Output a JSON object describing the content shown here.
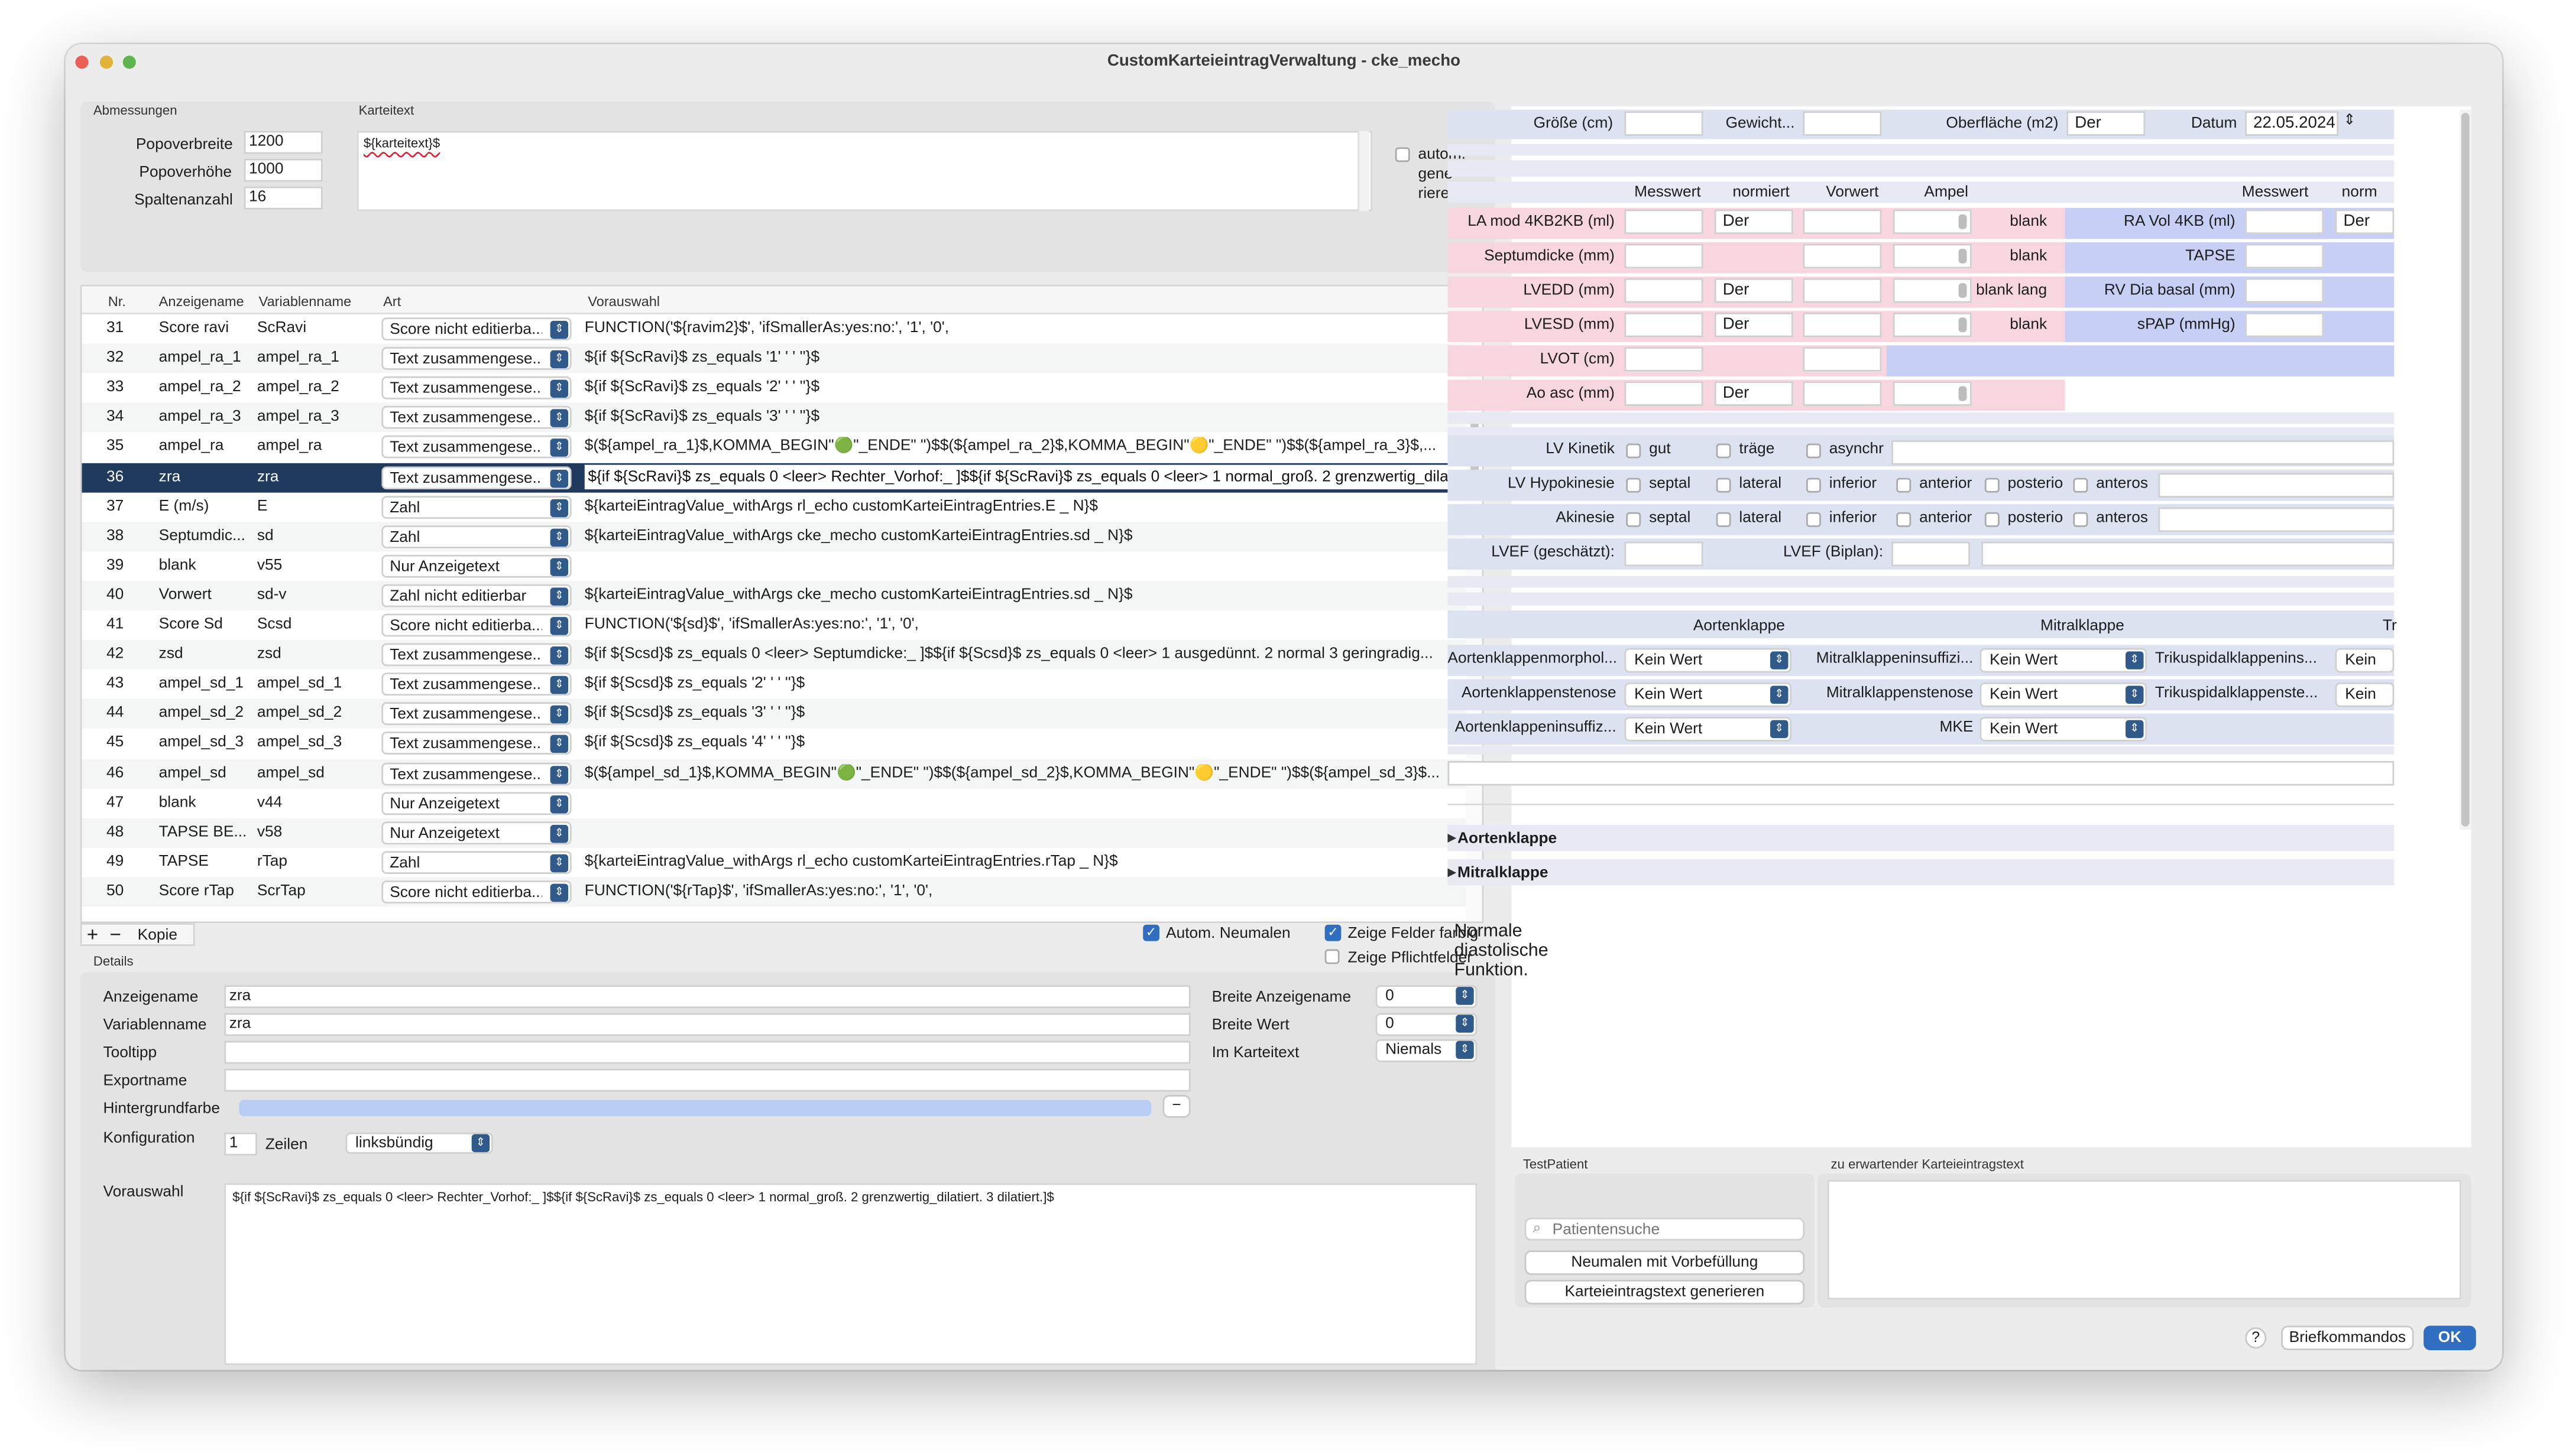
{
  "window": {
    "title": "CustomKarteieintragVerwaltung - cke_mecho"
  },
  "dims": {
    "label": "Abmessungen",
    "popbreite_l": "Popoverbreite",
    "popbreite_v": "1200",
    "pophoehe_l": "Popoverhöhe",
    "pophoehe_v": "1000",
    "spalten_l": "Spaltenanzahl",
    "spalten_v": "16"
  },
  "karteitext": {
    "label": "Karteitext",
    "value": "${karteitext}$",
    "autom_line1": "autom.",
    "autom_line2": "gene-",
    "autom_line3": "rieren"
  },
  "table": {
    "headers": {
      "nr": "Nr.",
      "anzeigename": "Anzeigename",
      "variablenname": "Variablenname",
      "art": "Art",
      "vorauswahl": "Vorauswahl"
    },
    "rows": [
      {
        "nr": "31",
        "an": "Score ravi",
        "vn": "ScRavi",
        "art": "Score nicht editierba...",
        "vw": "FUNCTION('${ravim2}$', 'ifSmallerAs:yes:no:', '1', '0',"
      },
      {
        "nr": "32",
        "an": "ampel_ra_1",
        "vn": "ampel_ra_1",
        "art": "Text zusammengese...",
        "vw": "${if ${ScRavi}$ zs_equals '1' ' ' ''}$"
      },
      {
        "nr": "33",
        "an": "ampel_ra_2",
        "vn": "ampel_ra_2",
        "art": "Text zusammengese...",
        "vw": "${if ${ScRavi}$ zs_equals '2' ' ' ''}$"
      },
      {
        "nr": "34",
        "an": "ampel_ra_3",
        "vn": "ampel_ra_3",
        "art": "Text zusammengese...",
        "vw": "${if ${ScRavi}$ zs_equals '3' ' ' ''}$"
      },
      {
        "nr": "35",
        "an": "ampel_ra",
        "vn": "ampel_ra",
        "art": "Text zusammengese...",
        "vw": "$(${ampel_ra_1}$,KOMMA_BEGIN\"🟢\"_ENDE\" \")$$(${ampel_ra_2}$,KOMMA_BEGIN\"🟡\"_ENDE\" \")$$(${ampel_ra_3}$,..."
      },
      {
        "nr": "36",
        "an": "zra",
        "vn": "zra",
        "art": "Text zusammengese...",
        "vw": "${if ${ScRavi}$ zs_equals 0 <leer> Rechter_Vorhof:_ ]$${if ${ScRavi}$ zs_equals 0 <leer> 1 normal_groß. 2 grenzwertig_dila"
      },
      {
        "nr": "37",
        "an": "E (m/s)",
        "vn": "E",
        "art": "Zahl",
        "vw": "${karteiEintragValue_withArgs rl_echo customKarteiEintragEntries.E _ N}$"
      },
      {
        "nr": "38",
        "an": "Septumdic...",
        "vn": "sd",
        "art": "Zahl",
        "vw": "${karteiEintragValue_withArgs cke_mecho customKarteiEintragEntries.sd _ N}$"
      },
      {
        "nr": "39",
        "an": "blank",
        "vn": "v55",
        "art": "Nur Anzeigetext",
        "vw": ""
      },
      {
        "nr": "40",
        "an": "Vorwert",
        "vn": "sd-v",
        "art": "Zahl nicht editierbar",
        "vw": "${karteiEintragValue_withArgs cke_mecho customKarteiEintragEntries.sd _ N}$"
      },
      {
        "nr": "41",
        "an": "Score Sd",
        "vn": "Scsd",
        "art": "Score nicht editierba...",
        "vw": "FUNCTION('${sd}$', 'ifSmallerAs:yes:no:', '1', '0',"
      },
      {
        "nr": "42",
        "an": "zsd",
        "vn": "zsd",
        "art": "Text zusammengese...",
        "vw": "${if ${Scsd}$ zs_equals 0 <leer> Septumdicke:_ ]$${if ${Scsd}$ zs_equals 0 <leer> 1 ausgedünnt. 2 normal 3 geringradig..."
      },
      {
        "nr": "43",
        "an": "ampel_sd_1",
        "vn": "ampel_sd_1",
        "art": "Text zusammengese...",
        "vw": "${if ${Scsd}$ zs_equals '2' ' ' ''}$"
      },
      {
        "nr": "44",
        "an": "ampel_sd_2",
        "vn": "ampel_sd_2",
        "art": "Text zusammengese...",
        "vw": "${if ${Scsd}$ zs_equals '3' ' ' ''}$"
      },
      {
        "nr": "45",
        "an": "ampel_sd_3",
        "vn": "ampel_sd_3",
        "art": "Text zusammengese...",
        "vw": "${if ${Scsd}$ zs_equals '4' ' ' ''}$"
      },
      {
        "nr": "46",
        "an": "ampel_sd",
        "vn": "ampel_sd",
        "art": "Text zusammengese...",
        "vw": "$(${ampel_sd_1}$,KOMMA_BEGIN\"🟢\"_ENDE\" \")$$(${ampel_sd_2}$,KOMMA_BEGIN\"🟡\"_ENDE\" \")$$(${ampel_sd_3}$..."
      },
      {
        "nr": "47",
        "an": "blank",
        "vn": "v44",
        "art": "Nur Anzeigetext",
        "vw": ""
      },
      {
        "nr": "48",
        "an": "TAPSE BE...",
        "vn": "v58",
        "art": "Nur Anzeigetext",
        "vw": ""
      },
      {
        "nr": "49",
        "an": "TAPSE",
        "vn": "rTap",
        "art": "Zahl",
        "vw": "${karteiEintragValue_withArgs rl_echo customKarteiEintragEntries.rTap _ N}$"
      },
      {
        "nr": "50",
        "an": "Score rTap",
        "vn": "ScrTap",
        "art": "Score nicht editierba...",
        "vw": "FUNCTION('${rTap}$', 'ifSmallerAs:yes:no:', '1', '0',"
      }
    ]
  },
  "tabletools": {
    "add": "+",
    "remove": "−",
    "copy": "Kopie",
    "autom_neumalen": "Autom. Neumalen",
    "zeige_farbig": "Zeige Felder farbig",
    "zeige_pflicht": "Zeige Pflichtfelder"
  },
  "details": {
    "label": "Details",
    "anzeigename_l": "Anzeigename",
    "anzeigename_v": "zra",
    "variablenname_l": "Variablenname",
    "variablenname_v": "zra",
    "tooltipp_l": "Tooltipp",
    "exportname_l": "Exportname",
    "hintergrund_l": "Hintergrundfarbe",
    "minus": "−",
    "konfig_l": "Konfiguration",
    "zeilen_v": "1",
    "zeilen_l": "Zeilen",
    "ausrichtung": "linksbündig",
    "breite_anz_l": "Breite Anzeigename",
    "breite_anz_v": "0",
    "breite_wert_l": "Breite Wert",
    "breite_wert_v": "0",
    "im_karteitext_l": "Im Karteitext",
    "im_karteitext_v": "Niemals",
    "vorauswahl_l": "Vorauswahl",
    "vorauswahl_v": "${if ${ScRavi}$ zs_equals 0 <leer> Rechter_Vorhof:_ ]$${if ${ScRavi}$ zs_equals 0 <leer> 1 normal_groß. 2 grenzwertig_dilatiert. 3 dilatiert.]$"
  },
  "preview": {
    "groesse": "Größe (cm)",
    "gewicht": "Gewicht...",
    "oberflaeche": "Oberfläche (m2)",
    "oberflaeche_v": "Der",
    "datum": "Datum",
    "datum_v": "22.05.2024",
    "h_messwert": "Messwert",
    "h_normiert": "normiert",
    "h_vorwert": "Vorwert",
    "h_ampel": "Ampel",
    "h_messwert2": "Messwert",
    "h_norm2": "norm",
    "lamod": "LA mod 4KB2KB (ml)",
    "lamod_n": "Der",
    "blank1": "blank",
    "ravol": "RA Vol 4KB (ml)",
    "ravol_n": "Der",
    "septum": "Septumdicke (mm)",
    "blank2": "blank",
    "tapse": "TAPSE",
    "lvedd": "LVEDD (mm)",
    "lvedd_n": "Der",
    "blanklang": "blank lang",
    "rvdia": "RV Dia basal (mm)",
    "lvesd": "LVESD (mm)",
    "lvesd_n": "Der",
    "blank3": "blank",
    "spap": "sPAP (mmHg)",
    "lvot": "LVOT (cm)",
    "aoasc": "Ao asc (mm)",
    "aoasc_n": "Der",
    "lvkinetik": "LV Kinetik",
    "gut": "gut",
    "traege": "träge",
    "asynchr": "asynchr",
    "lvhypo": "LV Hypokinesie",
    "septal": "septal",
    "lateral": "lateral",
    "inferior": "inferior",
    "anterior": "anterior",
    "posterio": "posterio",
    "anteros": "anteros",
    "akinesie": "Akinesie",
    "lvef_g": "LVEF (geschätzt):",
    "lvef_b": "LVEF (Biplan):",
    "aortenklappe": "Aortenklappe",
    "mitralklappe": "Mitralklappe",
    "tr": "Tr",
    "ak_morph": "Aortenklappenmorphol...",
    "mk_insuff": "Mitralklappeninsuffizi...",
    "tk_insuff": "Trikuspidalklappenins...",
    "ak_sten": "Aortenklappenstenose",
    "mk_sten": "Mitralklappenstenose",
    "tk_sten": "Trikuspidalklappenste...",
    "ak_insuff": "Aortenklappeninsuffiz...",
    "mke": "MKE",
    "keinwert": "Kein Wert",
    "keinw_trunc": "Kein W",
    "disc_ak": "Aortenklappe",
    "disc_mk": "Mitralklappe",
    "text": "Normale diastolische Funktion."
  },
  "testpatient": {
    "label": "TestPatient",
    "search_placeholder": "Patientensuche",
    "neumalen": "Neumalen mit Vorbefüllung",
    "generieren": "Karteieintragstext generieren",
    "expected_l": "zu erwartender Karteieintragstext"
  },
  "footer": {
    "help": "?",
    "brief": "Briefkommandos",
    "ok": "OK"
  }
}
